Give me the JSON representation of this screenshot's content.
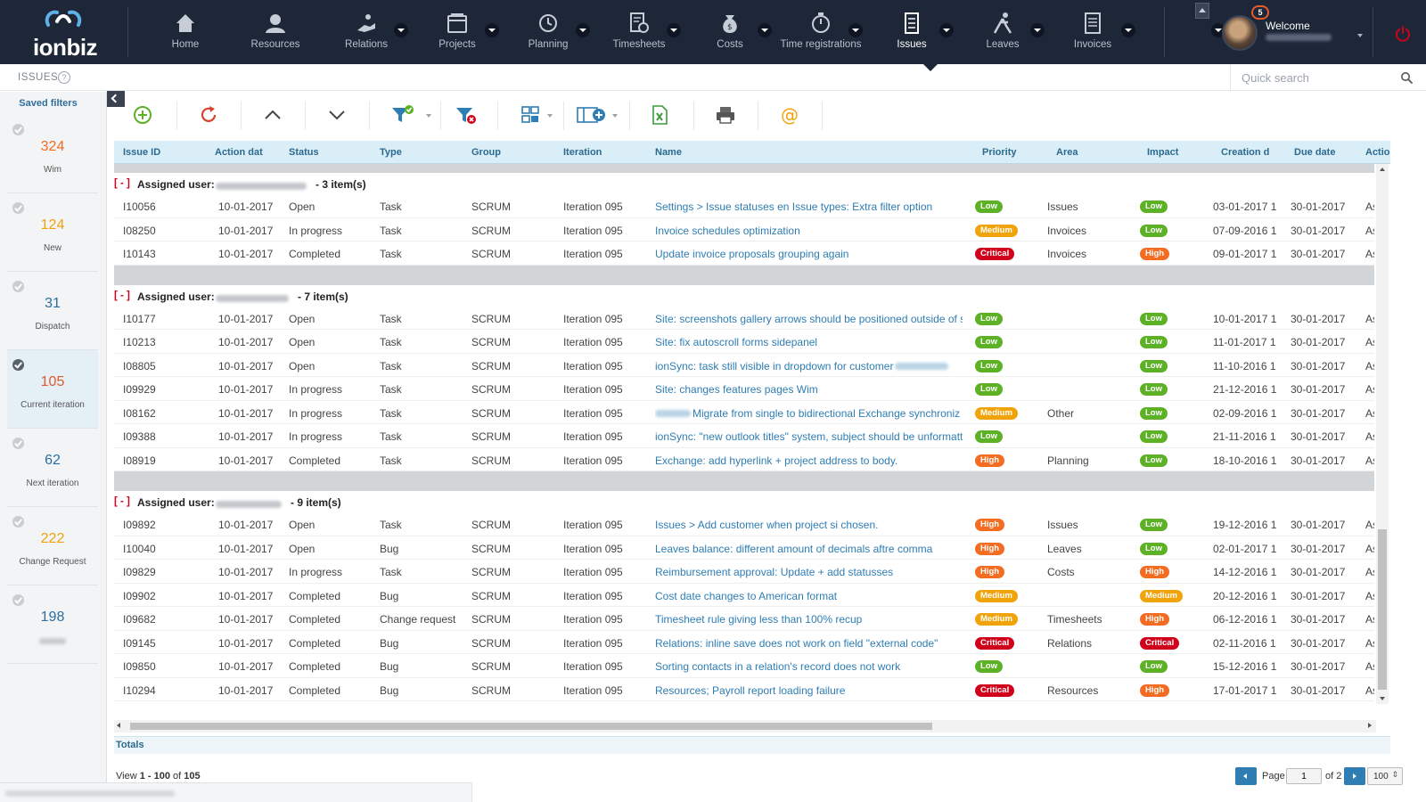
{
  "brand": {
    "name": "ionbiz"
  },
  "nav": [
    {
      "label": "Home",
      "icon": "home-icon"
    },
    {
      "label": "Resources",
      "icon": "resources-icon",
      "dropdown": true
    },
    {
      "label": "Relations",
      "icon": "relations-icon",
      "dropdown": true
    },
    {
      "label": "Projects",
      "icon": "projects-icon",
      "dropdown": true
    },
    {
      "label": "Planning",
      "icon": "planning-icon",
      "dropdown": true
    },
    {
      "label": "Timesheets",
      "icon": "timesheets-icon",
      "dropdown": true
    },
    {
      "label": "Costs",
      "icon": "costs-icon",
      "dropdown": true
    },
    {
      "label": "Time registrations",
      "icon": "stopwatch-icon",
      "dropdown": true
    },
    {
      "label": "Issues",
      "icon": "issues-icon",
      "dropdown": true,
      "active": true
    },
    {
      "label": "Leaves",
      "icon": "leaves-icon",
      "dropdown": true
    },
    {
      "label": "Invoices",
      "icon": "invoices-icon",
      "dropdown": true
    }
  ],
  "user": {
    "welcome": "Welcome",
    "notifications": "5"
  },
  "subheader": {
    "title": "ISSUES",
    "info": "?",
    "search_placeholder": "Quick search"
  },
  "sidebar": {
    "title": "Saved filters",
    "filters": [
      {
        "count": "324",
        "name": "Wim",
        "color": "#f36c21"
      },
      {
        "count": "124",
        "name": "New",
        "color": "#f0a30a"
      },
      {
        "count": "31",
        "name": "Dispatch",
        "color": "#2e6e9e"
      },
      {
        "count": "105",
        "name": "Current iteration",
        "color": "#e05a2a",
        "active": true
      },
      {
        "count": "62",
        "name": "Next iteration",
        "color": "#2e6e9e"
      },
      {
        "count": "222",
        "name": "Change Request",
        "color": "#f0a30a"
      },
      {
        "count": "198",
        "name": "",
        "color": "#2e6e9e"
      }
    ]
  },
  "toolbar": [
    {
      "name": "add-icon"
    },
    {
      "name": "refresh-icon"
    },
    {
      "name": "collapse-up-icon"
    },
    {
      "name": "expand-down-icon"
    },
    {
      "name": "filter-check-icon"
    },
    {
      "name": "filter-clear-icon"
    },
    {
      "name": "group-icon"
    },
    {
      "name": "columns-icon"
    },
    {
      "name": "excel-icon"
    },
    {
      "name": "print-icon"
    },
    {
      "name": "email-icon"
    }
  ],
  "columns": [
    "Issue ID",
    "Action dat",
    "Status",
    "Type",
    "Group",
    "Iteration",
    "Name",
    "Priority",
    "Area",
    "Impact",
    "Creation d",
    "Due date",
    "Actio"
  ],
  "groups": [
    {
      "toggle": "[ - ]",
      "label": "Assigned user:",
      "count_text": "- 3 item(s)",
      "rows": [
        {
          "id": "I10056",
          "action": "10-01-2017",
          "status": "Open",
          "type": "Task",
          "group": "SCRUM",
          "iteration": "Iteration 095",
          "name": "Settings > Issue statuses en Issue types: Extra filter option",
          "priority": "Low",
          "area": "Issues",
          "impact": "Low",
          "created": "03-01-2017 1",
          "due": "30-01-2017",
          "act": "As"
        },
        {
          "id": "I08250",
          "action": "10-01-2017",
          "status": "In progress",
          "type": "Task",
          "group": "SCRUM",
          "iteration": "Iteration 095",
          "name": "Invoice schedules optimization",
          "priority": "Medium",
          "area": "Invoices",
          "impact": "Low",
          "created": "07-09-2016 1",
          "due": "30-01-2017",
          "act": "As"
        },
        {
          "id": "I10143",
          "action": "10-01-2017",
          "status": "Completed",
          "type": "Task",
          "group": "SCRUM",
          "iteration": "Iteration 095",
          "name": "Update invoice proposals grouping again",
          "priority": "Critical",
          "area": "Invoices",
          "impact": "High",
          "created": "09-01-2017 1",
          "due": "30-01-2017",
          "act": "As"
        }
      ]
    },
    {
      "toggle": "[ - ]",
      "label": "Assigned user:",
      "count_text": "- 7 item(s)",
      "rows": [
        {
          "id": "I10177",
          "action": "10-01-2017",
          "status": "Open",
          "type": "Task",
          "group": "SCRUM",
          "iteration": "Iteration 095",
          "name": "Site: screenshots gallery arrows should be positioned outside of s",
          "priority": "Low",
          "area": "",
          "impact": "Low",
          "created": "10-01-2017 1",
          "due": "30-01-2017",
          "act": "As"
        },
        {
          "id": "I10213",
          "action": "10-01-2017",
          "status": "Open",
          "type": "Task",
          "group": "SCRUM",
          "iteration": "Iteration 095",
          "name": "Site: fix autoscroll forms sidepanel",
          "priority": "Low",
          "area": "",
          "impact": "Low",
          "created": "11-01-2017 1",
          "due": "30-01-2017",
          "act": "As"
        },
        {
          "id": "I08805",
          "action": "10-01-2017",
          "status": "Open",
          "type": "Task",
          "group": "SCRUM",
          "iteration": "Iteration 095",
          "name": "ionSync: task still visible in dropdown for customer",
          "name_blur_after": true,
          "priority": "Low",
          "area": "",
          "impact": "Low",
          "created": "11-10-2016 1",
          "due": "30-01-2017",
          "act": "As"
        },
        {
          "id": "I09929",
          "action": "10-01-2017",
          "status": "In progress",
          "type": "Task",
          "group": "SCRUM",
          "iteration": "Iteration 095",
          "name": "Site: changes features pages Wim",
          "priority": "Low",
          "area": "",
          "impact": "Low",
          "created": "21-12-2016 1",
          "due": "30-01-2017",
          "act": "As"
        },
        {
          "id": "I08162",
          "action": "10-01-2017",
          "status": "In progress",
          "type": "Task",
          "group": "SCRUM",
          "iteration": "Iteration 095",
          "name": "Migrate from single to bidirectional Exchange synchroniz",
          "name_blur_before": true,
          "priority": "Medium",
          "area": "Other",
          "impact": "Low",
          "created": "02-09-2016 1",
          "due": "30-01-2017",
          "act": "As"
        },
        {
          "id": "I09388",
          "action": "10-01-2017",
          "status": "In progress",
          "type": "Task",
          "group": "SCRUM",
          "iteration": "Iteration 095",
          "name": "ionSync: \"new outlook titles\" system, subject should be unformatte",
          "priority": "Low",
          "area": "",
          "impact": "Low",
          "created": "21-11-2016 1",
          "due": "30-01-2017",
          "act": "As"
        },
        {
          "id": "I08919",
          "action": "10-01-2017",
          "status": "Completed",
          "type": "Task",
          "group": "SCRUM",
          "iteration": "Iteration 095",
          "name": "Exchange: add hyperlink + project address to body.",
          "priority": "High",
          "area": "Planning",
          "impact": "Low",
          "created": "18-10-2016 1",
          "due": "30-01-2017",
          "act": "As"
        }
      ]
    },
    {
      "toggle": "[ - ]",
      "label": "Assigned user:",
      "count_text": "- 9 item(s)",
      "rows": [
        {
          "id": "I09892",
          "action": "10-01-2017",
          "status": "Open",
          "type": "Task",
          "group": "SCRUM",
          "iteration": "Iteration 095",
          "name": "Issues > Add customer when project si chosen.",
          "priority": "High",
          "area": "Issues",
          "impact": "Low",
          "created": "19-12-2016 1",
          "due": "30-01-2017",
          "act": "As"
        },
        {
          "id": "I10040",
          "action": "10-01-2017",
          "status": "Open",
          "type": "Bug",
          "group": "SCRUM",
          "iteration": "Iteration 095",
          "name": "Leaves balance: different amount of decimals aftre comma",
          "priority": "High",
          "area": "Leaves",
          "impact": "Low",
          "created": "02-01-2017 1",
          "due": "30-01-2017",
          "act": "As"
        },
        {
          "id": "I09829",
          "action": "10-01-2017",
          "status": "In progress",
          "type": "Task",
          "group": "SCRUM",
          "iteration": "Iteration 095",
          "name": "Reimbursement approval: Update + add statusses",
          "priority": "High",
          "area": "Costs",
          "impact": "High",
          "created": "14-12-2016 1",
          "due": "30-01-2017",
          "act": "As"
        },
        {
          "id": "I09902",
          "action": "10-01-2017",
          "status": "Completed",
          "type": "Bug",
          "group": "SCRUM",
          "iteration": "Iteration 095",
          "name": "Cost date changes to American format",
          "priority": "Medium",
          "area": "",
          "impact": "Medium",
          "created": "20-12-2016 1",
          "due": "30-01-2017",
          "act": "As"
        },
        {
          "id": "I09682",
          "action": "10-01-2017",
          "status": "Completed",
          "type": "Change request",
          "group": "SCRUM",
          "iteration": "Iteration 095",
          "name": "Timesheet rule giving less than 100% recup",
          "priority": "Medium",
          "area": "Timesheets",
          "impact": "High",
          "created": "06-12-2016 1",
          "due": "30-01-2017",
          "act": "As"
        },
        {
          "id": "I09145",
          "action": "10-01-2017",
          "status": "Completed",
          "type": "Bug",
          "group": "SCRUM",
          "iteration": "Iteration 095",
          "name": "Relations: inline save does not work on field \"external code\"",
          "priority": "Critical",
          "area": "Relations",
          "impact": "Critical",
          "created": "02-11-2016 1",
          "due": "30-01-2017",
          "act": "As"
        },
        {
          "id": "I09850",
          "action": "10-01-2017",
          "status": "Completed",
          "type": "Bug",
          "group": "SCRUM",
          "iteration": "Iteration 095",
          "name": "Sorting contacts in a relation's record does not work",
          "priority": "Low",
          "area": "",
          "impact": "Low",
          "created": "15-12-2016 1",
          "due": "30-01-2017",
          "act": "As"
        },
        {
          "id": "I10294",
          "action": "10-01-2017",
          "status": "Completed",
          "type": "Bug",
          "group": "SCRUM",
          "iteration": "Iteration 095",
          "name": "Resources; Payroll report loading failure",
          "priority": "Critical",
          "area": "Resources",
          "impact": "High",
          "created": "17-01-2017 1",
          "due": "30-01-2017",
          "act": "As"
        }
      ]
    }
  ],
  "totals": {
    "label": "Totals"
  },
  "footer": {
    "view_prefix": "View",
    "view_range": "1 - 100",
    "view_of": "of",
    "view_total": "105",
    "page_label": "Page",
    "page_value": "1",
    "of_pages": "of 2",
    "page_size": "100"
  }
}
